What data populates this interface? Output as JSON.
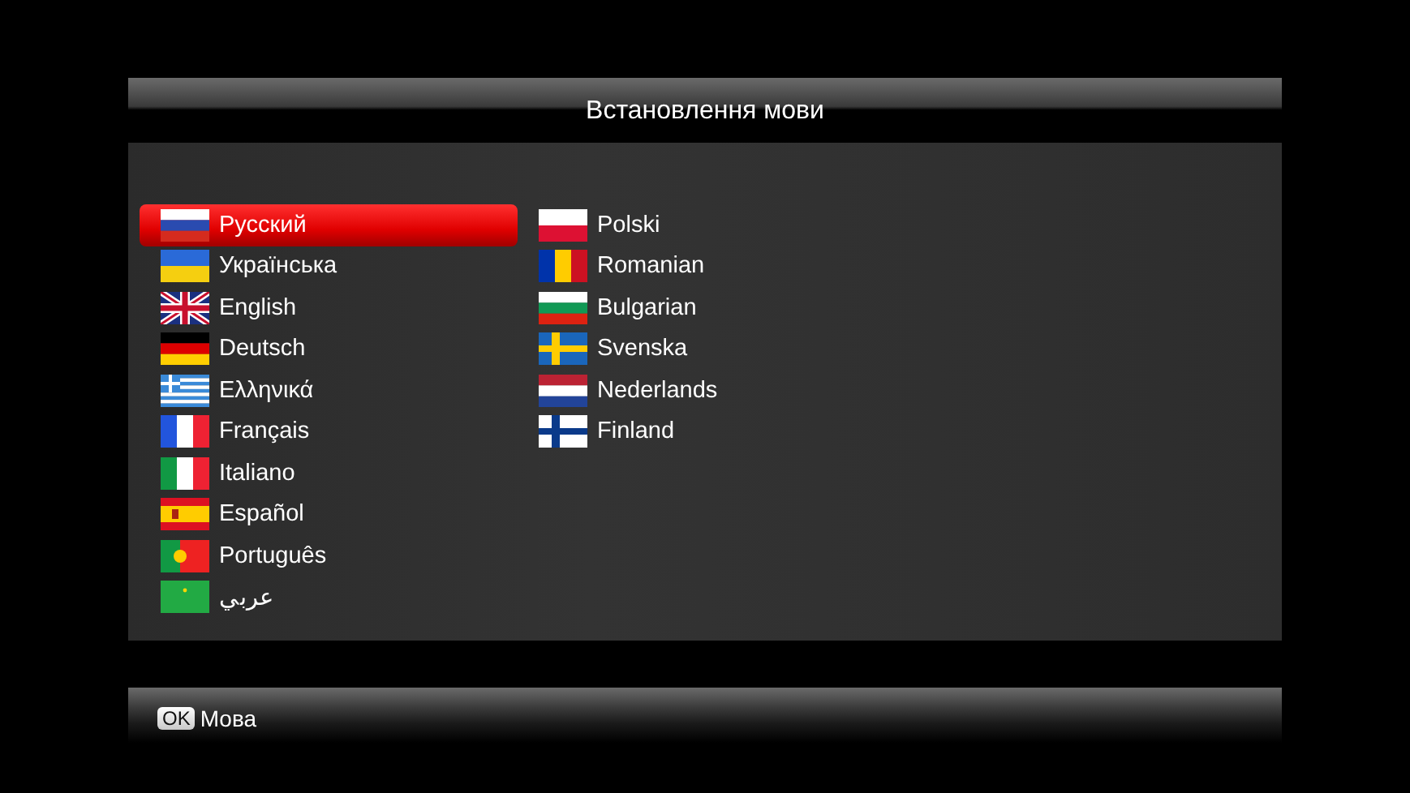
{
  "title": "Встановлення мови",
  "columns": [
    [
      {
        "label": "Русский",
        "selected": true
      },
      {
        "label": "Українська",
        "selected": false
      },
      {
        "label": "English",
        "selected": false
      },
      {
        "label": "Deutsch",
        "selected": false
      },
      {
        "label": "Ελληνικά",
        "selected": false
      },
      {
        "label": "Français",
        "selected": false
      },
      {
        "label": "Italiano",
        "selected": false
      },
      {
        "label": "Español",
        "selected": false
      },
      {
        "label": "Português",
        "selected": false
      },
      {
        "label": "عربي",
        "selected": false
      }
    ],
    [
      {
        "label": "Polski",
        "selected": false
      },
      {
        "label": "Romanian",
        "selected": false
      },
      {
        "label": "Bulgarian",
        "selected": false
      },
      {
        "label": "Svenska",
        "selected": false
      },
      {
        "label": "Nederlands",
        "selected": false
      },
      {
        "label": "Finland",
        "selected": false
      }
    ]
  ],
  "footer": {
    "key": "OK",
    "label": "Мова"
  }
}
